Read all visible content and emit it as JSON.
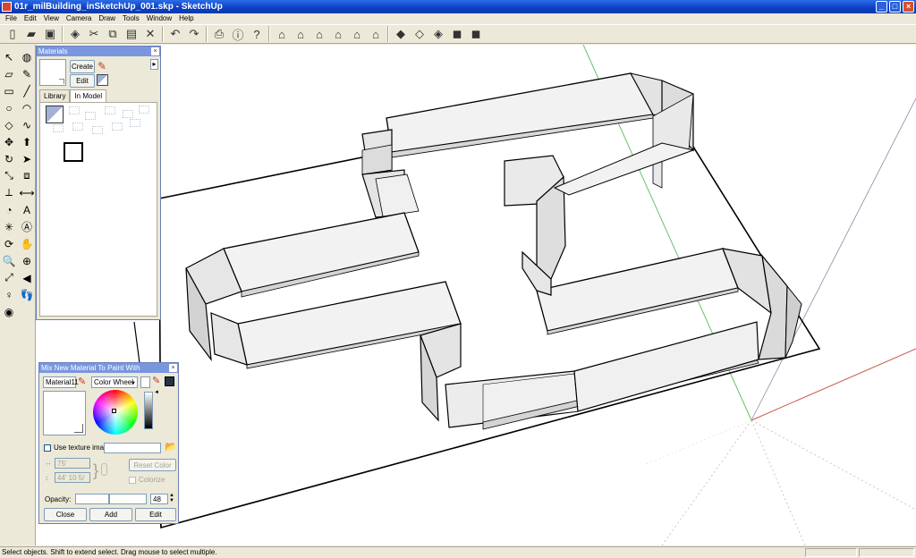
{
  "window": {
    "title": "01r_milBuilding_inSketchUp_001.skp - SketchUp",
    "buttons": {
      "minimize": "_",
      "maximize": "□",
      "close": "×"
    }
  },
  "menu": [
    "File",
    "Edit",
    "View",
    "Camera",
    "Draw",
    "Tools",
    "Window",
    "Help"
  ],
  "toolbar": {
    "icons": [
      "new-icon",
      "open-icon",
      "save-icon",
      "make-component-icon",
      "cut-icon",
      "copy-icon",
      "paste-icon",
      "erase-icon",
      "undo-icon",
      "redo-icon",
      "print-icon",
      "model-info-icon",
      "help-icon",
      "iso-view-icon",
      "top-view-icon",
      "front-view-icon",
      "right-view-icon",
      "back-view-icon",
      "left-view-icon",
      "xray-icon",
      "wireframe-icon",
      "hidden-line-icon",
      "shaded-icon",
      "shaded-texture-icon"
    ],
    "glyphs": [
      "▯",
      "▰",
      "▣",
      "◈",
      "✂",
      "⧉",
      "▤",
      "✕",
      "↶",
      "↷",
      "⎙",
      "ⓘ",
      "?",
      "⌂",
      "⌂",
      "⌂",
      "⌂",
      "⌂",
      "⌂",
      "◆",
      "◇",
      "◈",
      "◼",
      "◼"
    ]
  },
  "left_toolbar": {
    "icons": [
      "select-icon",
      "paint-bucket-icon",
      "eraser-icon",
      "pencil-icon",
      "rectangle-icon",
      "line-icon",
      "circle-icon",
      "arc-icon",
      "polygon-icon",
      "freehand-icon",
      "move-icon",
      "push-pull-icon",
      "rotate-icon",
      "follow-me-icon",
      "scale-icon",
      "offset-icon",
      "tape-measure-icon",
      "dimension-icon",
      "protractor-icon",
      "text-icon",
      "axes-icon",
      "3d-text-icon",
      "orbit-icon",
      "pan-icon",
      "zoom-icon",
      "zoom-window-icon",
      "zoom-extents-icon",
      "previous-view-icon",
      "position-camera-icon",
      "walk-icon",
      "look-around-icon"
    ],
    "glyphs": [
      "↖",
      "◍",
      "▱",
      "✎",
      "▭",
      "╱",
      "○",
      "◠",
      "◇",
      "∿",
      "✥",
      "⬆",
      "↻",
      "➤",
      "⤡",
      "⧈",
      "⟂",
      "⟷",
      "◔",
      "A",
      "✳",
      "Ⓐ",
      "⟳",
      "✋",
      "🔍",
      "⊕",
      "⤢",
      "◀",
      "♀",
      "👣",
      "◉"
    ]
  },
  "materials": {
    "title": "Materials",
    "create_label": "Create",
    "edit_label": "Edit",
    "tabs": [
      "Library",
      "In Model"
    ],
    "arrow": "▸",
    "close": "×"
  },
  "mix_material": {
    "title": "Mix New Material To Paint With",
    "name_value": "Material11",
    "picker_value": "Color Wheel",
    "use_texture_label": "Use texture image",
    "width_value": "75'",
    "height_value": "44' 10 5/",
    "reset_color_label": "Reset Color",
    "colorize_label": "Colorize",
    "opacity_label": "Opacity:",
    "opacity_value": "48",
    "close_label": "Close",
    "add_label": "Add",
    "edit_label": "Edit",
    "close": "×"
  },
  "status": {
    "text": "Select objects. Shift to extend select. Drag mouse to select multiple."
  },
  "colors": {
    "title_bar": "#0a3fc4",
    "chrome": "#ece9d8",
    "palette_title": "#7a96df",
    "wall_fill": "#e8e8e8",
    "wall_top": "#f4f4f4",
    "axis_green": "#6cbf6c",
    "axis_red": "#c85a4a"
  }
}
